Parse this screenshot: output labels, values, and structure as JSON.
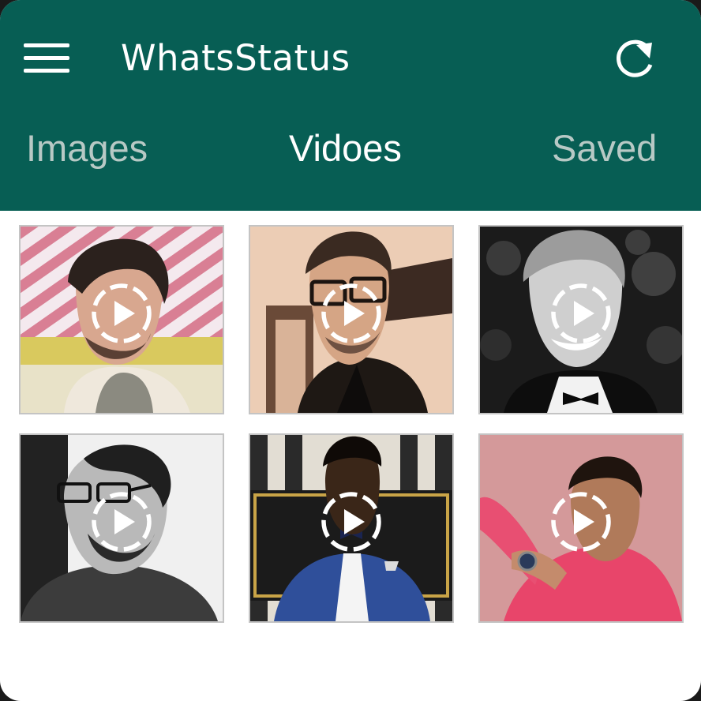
{
  "app": {
    "title": "WhatsStatus",
    "colors": {
      "header": "#075e54",
      "active_tab": "#ffffff",
      "inactive_tab": "#b7c9c5"
    }
  },
  "header": {
    "menu_icon": "hamburger-menu-icon",
    "refresh_icon": "refresh-icon"
  },
  "tabs": [
    {
      "label": "Images",
      "active": false
    },
    {
      "label": "Vidoes",
      "active": true
    },
    {
      "label": "Saved",
      "active": false
    }
  ],
  "videos": [
    {
      "icon": "play-icon"
    },
    {
      "icon": "play-icon"
    },
    {
      "icon": "play-icon"
    },
    {
      "icon": "play-icon"
    },
    {
      "icon": "play-icon"
    },
    {
      "icon": "play-icon"
    }
  ]
}
